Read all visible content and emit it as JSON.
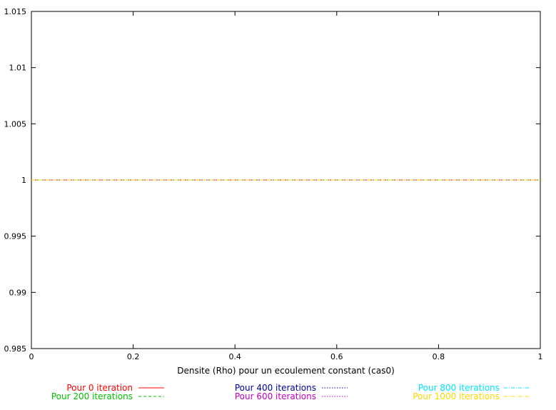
{
  "chart_data": {
    "type": "line",
    "title": "",
    "xlabel": "Densite (Rho) pour un ecoulement constant (cas0)",
    "ylabel": "",
    "xlim": [
      0,
      1
    ],
    "ylim": [
      0.985,
      1.015
    ],
    "xticks": [
      0,
      0.2,
      0.4,
      0.6,
      0.8,
      1
    ],
    "xtick_labels": [
      "0",
      "0.2",
      "0.4",
      "0.6",
      "0.8",
      "1"
    ],
    "yticks": [
      0.985,
      0.99,
      0.995,
      1,
      1.005,
      1.01,
      1.015
    ],
    "ytick_labels": [
      "0.985",
      "0.99",
      "0.995",
      "1",
      "1.005",
      "1.01",
      "1.015"
    ],
    "grid": false,
    "legend_position": "bottom",
    "x": [
      0,
      1
    ],
    "series": [
      {
        "name": "Pour 0 iteration",
        "values": [
          1,
          1
        ],
        "color": "#ff0000",
        "dash": "solid"
      },
      {
        "name": "Pour 200 iterations",
        "values": [
          1,
          1
        ],
        "color": "#00c000",
        "dash": "dashed"
      },
      {
        "name": "Pour 400 iterations",
        "values": [
          1,
          1
        ],
        "color": "#0000a0",
        "dash": "dotted"
      },
      {
        "name": "Pour 600 iterations",
        "values": [
          1,
          1
        ],
        "color": "#c000c0",
        "dash": "dotted"
      },
      {
        "name": "Pour 800 iterations",
        "values": [
          1,
          1
        ],
        "color": "#00e0ff",
        "dash": "dashdot"
      },
      {
        "name": "Pour 1000 iterations",
        "values": [
          1,
          1
        ],
        "color": "#ffd700",
        "dash": "dashdot"
      }
    ]
  }
}
